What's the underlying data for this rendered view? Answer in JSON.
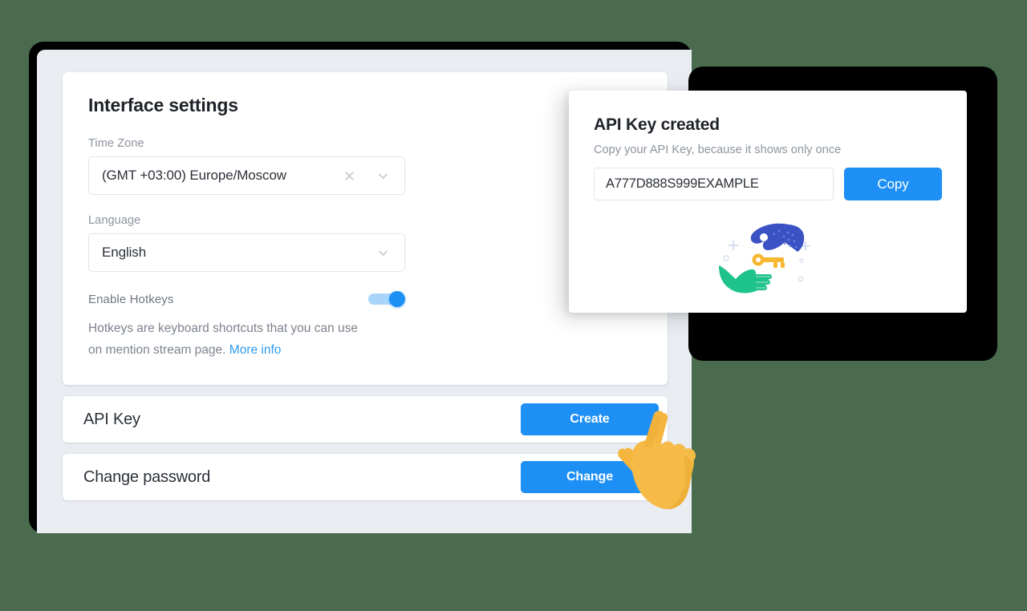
{
  "settings": {
    "section_title": "Interface settings",
    "fields": [
      {
        "label": "Time Zone",
        "value": "(GMT +03:00) Europe/Moscow",
        "clear_icon": "close-x-icon",
        "chevron_icon": "chevron-down-icon",
        "has_clear": true
      },
      {
        "label": "Language",
        "value": "English",
        "chevron_icon": "chevron-down-icon",
        "has_clear": false
      }
    ],
    "hotkeys": {
      "label": "Enable Hotkeys",
      "enabled": true,
      "description_part1": "Hotkeys are keyboard shortcuts that you can use on mention stream page.",
      "link_label": "More info"
    },
    "rows": [
      {
        "label": "API Key",
        "button_label": "Create"
      },
      {
        "label": "Change password",
        "button_label": "Change"
      }
    ]
  },
  "modal": {
    "title": "API Key created",
    "subtitle": "Copy your API Key, because it shows only once",
    "api_key_value": "A777D888S999EXAMPLE",
    "api_key_placeholder": "API Key",
    "copy_button_label": "Copy",
    "illustration": "hands-exchanging-key-illustration"
  },
  "cursor": {
    "icon": "pointing-hand-cursor"
  },
  "colors": {
    "accent_blue": "#1e90f5",
    "link_blue": "#2e9bf0",
    "page_background": "#e9edf2",
    "canvas_background": "#4a6b4e",
    "toggle_track": "#a9d5fb",
    "illus_blue": "#3b52c4",
    "illus_green": "#1ec28b",
    "illus_key_yellow": "#f5b82e"
  }
}
